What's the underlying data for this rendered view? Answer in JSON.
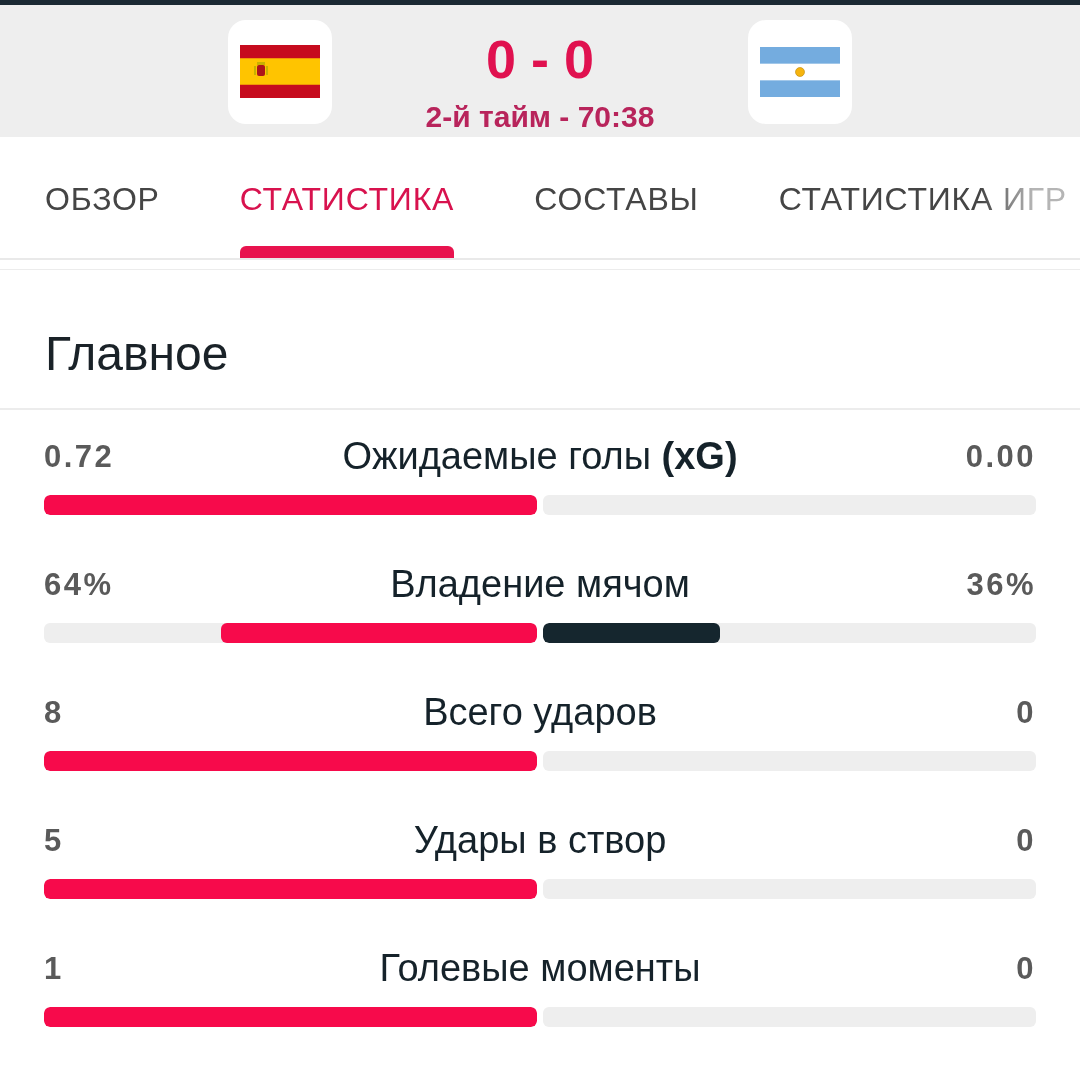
{
  "header": {
    "score": "0 - 0",
    "period": "2-й тайм - 70:38"
  },
  "tabs": [
    {
      "label": "ОБЗОР",
      "selected": false
    },
    {
      "label": "СТАТИСТИКА",
      "selected": true
    },
    {
      "label": "СОСТАВЫ",
      "selected": false
    },
    {
      "label": "СТАТИСТИКА ИГР",
      "selected": false
    }
  ],
  "section": {
    "title": "Главное",
    "stats": [
      {
        "label": "Ожидаемые голы **(xG)**",
        "home": {
          "value": "0.72",
          "level": 1
        },
        "away": {
          "value": "0.00"
        }
      },
      {
        "label": "Владение мячом",
        "home": {
          "value": "64%",
          "level": 0.64
        },
        "away": {
          "value": "36%",
          "level": 0.36
        }
      },
      {
        "label": "Всего ударов",
        "home": {
          "value": "8",
          "level": 1
        },
        "away": {
          "value": "0"
        }
      },
      {
        "label": "Удары в створ",
        "home": {
          "value": "5",
          "level": 1
        },
        "away": {
          "value": "0"
        }
      },
      {
        "label": "Голевые моменты",
        "home": {
          "value": "1",
          "level": 1
        },
        "away": {
          "value": "0"
        }
      }
    ]
  }
}
